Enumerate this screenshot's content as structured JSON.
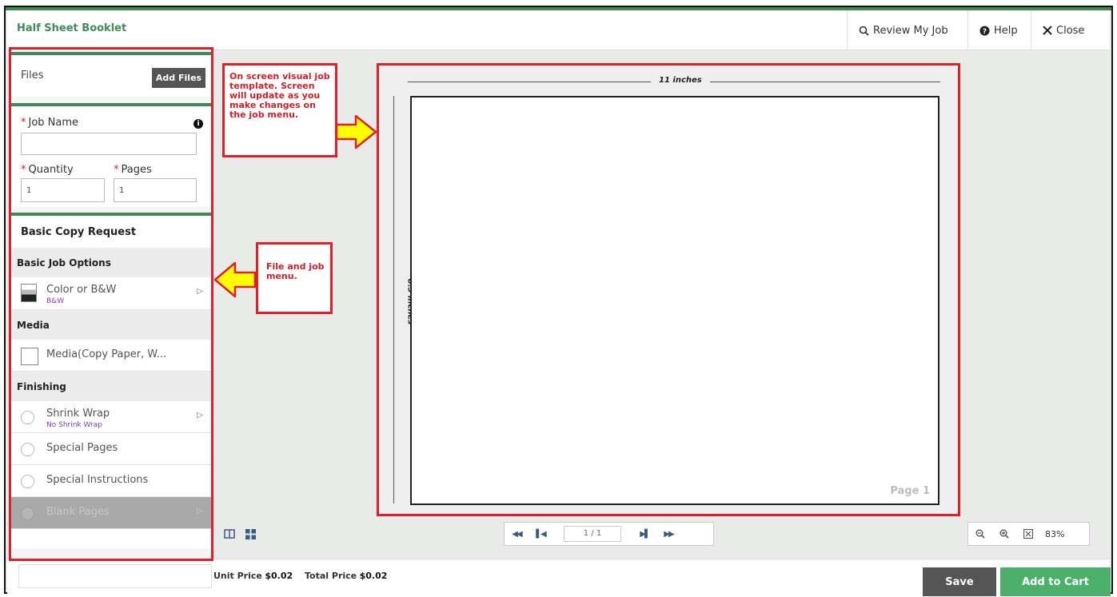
{
  "header": {
    "title": "Half Sheet Booklet",
    "review_label": "Review My Job",
    "help_label": "Help",
    "close_label": "Close"
  },
  "files": {
    "label": "Files",
    "add_button": "Add Files"
  },
  "job": {
    "job_name_label": "Job Name",
    "job_name_value": "",
    "quantity_label": "Quantity",
    "quantity_value": "1",
    "pages_label": "Pages",
    "pages_value": "1",
    "required_marker": "*"
  },
  "options": {
    "title": "Basic Copy Request",
    "basic_heading": "Basic Job Options",
    "color": {
      "name": "Color or B&W",
      "value": "B&W"
    },
    "media_heading": "Media",
    "media": {
      "name": "Media(Copy Paper, W..."
    },
    "finishing_heading": "Finishing",
    "shrink_wrap": {
      "name": "Shrink Wrap",
      "value": "No Shrink Wrap"
    },
    "special_pages": {
      "name": "Special Pages"
    },
    "special_instructions": {
      "name": "Special Instructions"
    },
    "blank_pages": {
      "name": "Blank Pages"
    }
  },
  "annotations": {
    "template_note": "On screen visual job template.  Screen will update as you make changes on the job menu.",
    "menu_note": "File and job menu."
  },
  "canvas": {
    "width_label": "11 inches",
    "height_label": "8.5 inches",
    "page_label": "Page 1"
  },
  "pager": {
    "current": "1 / 1"
  },
  "zoom": {
    "value": "83%"
  },
  "footer": {
    "unit_price_label": "Unit Price",
    "unit_price_value": "$0.02",
    "total_price_label": "Total Price",
    "total_price_value": "$0.02",
    "save_label": "Save",
    "cart_label": "Add to Cart"
  },
  "colors": {
    "accent_green": "#3f8c55",
    "annotation_red": "#e01f2a",
    "cart_green": "#4caf6b",
    "arrow_yellow": "#ffff00"
  }
}
